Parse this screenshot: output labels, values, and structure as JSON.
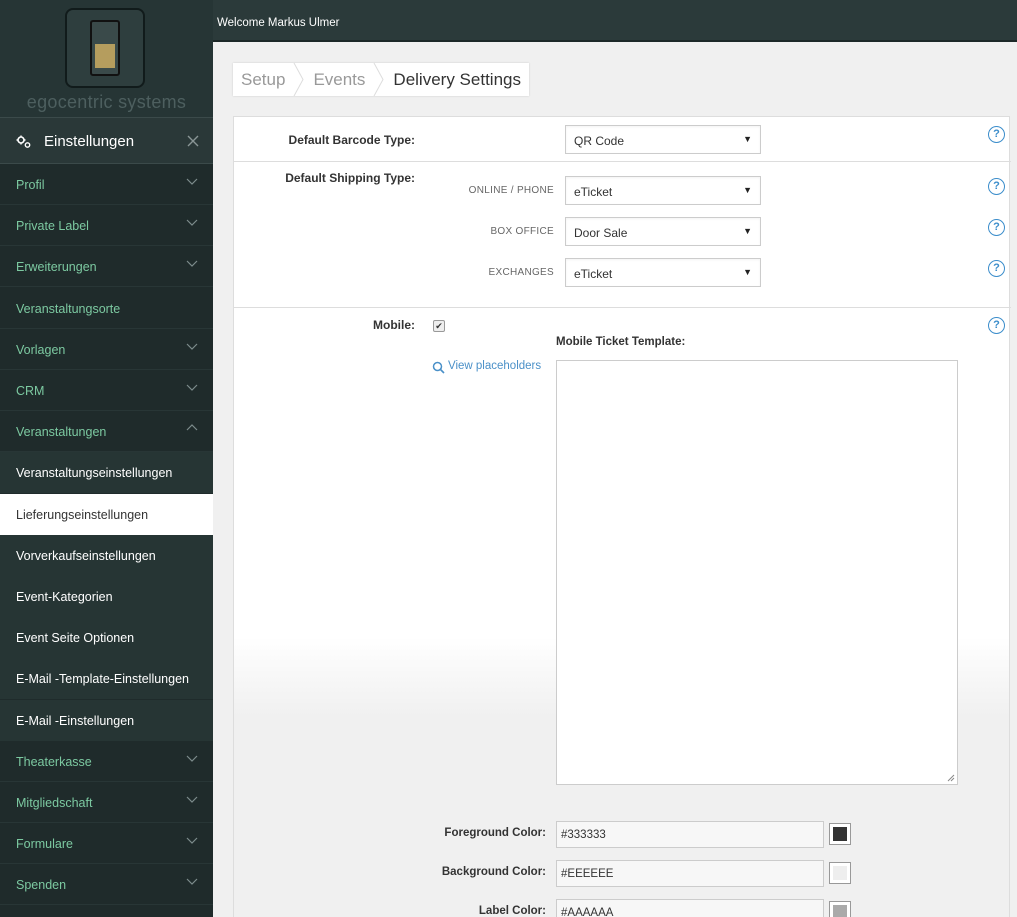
{
  "brand": {
    "name": "egocentric systems"
  },
  "header": {
    "welcome": "Welcome Markus Ulmer"
  },
  "sidebar": {
    "title": "Einstellungen",
    "items": [
      {
        "label": "Profil",
        "type": "main",
        "chevron": "down"
      },
      {
        "label": "Private Label",
        "type": "main",
        "chevron": "down"
      },
      {
        "label": "Erweiterungen",
        "type": "main",
        "chevron": "down"
      },
      {
        "label": "Veranstaltungsorte",
        "type": "main",
        "chevron": "none"
      },
      {
        "label": "Vorlagen",
        "type": "main",
        "chevron": "down"
      },
      {
        "label": "CRM",
        "type": "main",
        "chevron": "down"
      },
      {
        "label": "Veranstaltungen",
        "type": "main",
        "chevron": "up"
      },
      {
        "label": "Veranstaltungseinstellungen",
        "type": "sub",
        "chevron": "none"
      },
      {
        "label": "Lieferungseinstellungen",
        "type": "active",
        "chevron": "none"
      },
      {
        "label": "Vorverkaufseinstellungen",
        "type": "sub",
        "chevron": "none"
      },
      {
        "label": "Event-Kategorien",
        "type": "sub",
        "chevron": "none"
      },
      {
        "label": "Event Seite Optionen",
        "type": "sub",
        "chevron": "none"
      },
      {
        "label": "E-Mail -Template-Einstellungen",
        "type": "sub",
        "chevron": "none"
      },
      {
        "label": "E-Mail -Einstellungen",
        "type": "sub",
        "chevron": "none"
      },
      {
        "label": "Theaterkasse",
        "type": "main",
        "chevron": "down"
      },
      {
        "label": "Mitgliedschaft",
        "type": "main",
        "chevron": "down"
      },
      {
        "label": "Formulare",
        "type": "main",
        "chevron": "down"
      },
      {
        "label": "Spenden",
        "type": "main",
        "chevron": "down"
      }
    ]
  },
  "breadcrumb": [
    "Setup",
    "Events",
    "Delivery Settings"
  ],
  "form": {
    "barcode": {
      "label": "Default Barcode Type:",
      "value": "QR Code"
    },
    "shipping": {
      "label": "Default Shipping Type:",
      "online_label": "ONLINE / PHONE",
      "online_value": "eTicket",
      "box_label": "BOX OFFICE",
      "box_value": "Door Sale",
      "exchanges_label": "EXCHANGES",
      "exchanges_value": "eTicket"
    },
    "mobile": {
      "label": "Mobile:",
      "checked": true,
      "template_label": "Mobile Ticket Template:",
      "placeholders_link": "View placeholders",
      "template_value": ""
    },
    "colors": {
      "foreground_label": "Foreground Color:",
      "foreground_value": "#333333",
      "background_label": "Background Color:",
      "background_value": "#EEEEEE",
      "label_label": "Label Color:",
      "label_value": "#AAAAAA"
    },
    "help_icon": "?"
  },
  "theme": {
    "accent": "#7cc9a1",
    "sidebar_bg": "#1f2b2b",
    "link": "#4a90c8"
  }
}
